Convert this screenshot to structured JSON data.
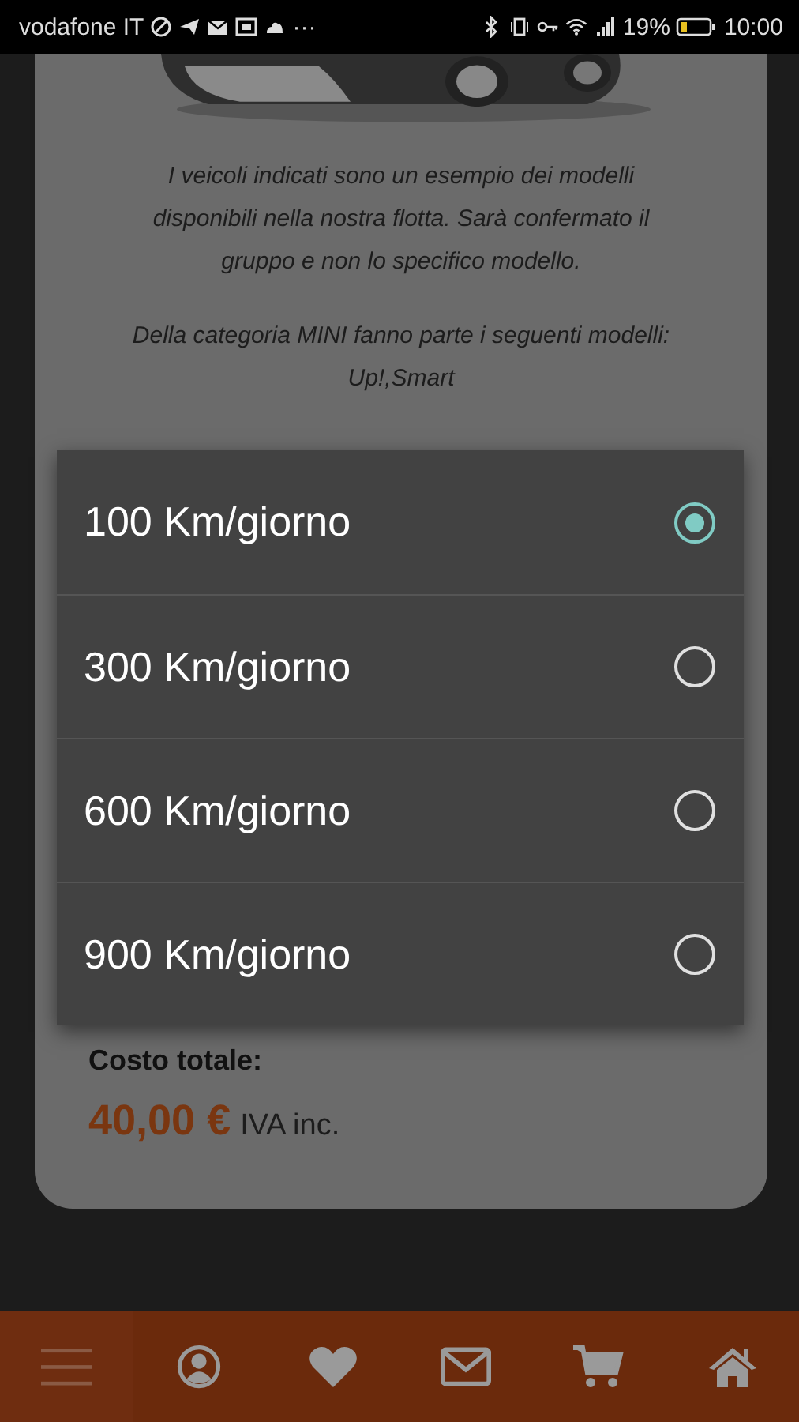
{
  "status_bar": {
    "carrier": "vodafone IT",
    "more": "···",
    "battery": "19%",
    "time": "10:00"
  },
  "card": {
    "paragraphs": [
      "I veicoli indicati sono un esempio dei modelli disponibili nella nostra flotta. Sarà confermato il gruppo e non lo specifico modello.",
      "Della categoria MINI fanno parte i seguenti modelli: Up!,Smart"
    ],
    "total_label": "Costo totale:",
    "total_price": "40,00 €",
    "total_note": "IVA inc."
  },
  "dialog": {
    "options": [
      {
        "label": "100 Km/giorno",
        "selected": true
      },
      {
        "label": "300 Km/giorno",
        "selected": false
      },
      {
        "label": "600 Km/giorno",
        "selected": false
      },
      {
        "label": "900 Km/giorno",
        "selected": false
      }
    ]
  },
  "bottom_nav": {
    "items": [
      {
        "kind": "menu"
      },
      {
        "kind": "profile"
      },
      {
        "kind": "heart"
      },
      {
        "kind": "mail"
      },
      {
        "kind": "cart"
      },
      {
        "kind": "home"
      }
    ]
  }
}
